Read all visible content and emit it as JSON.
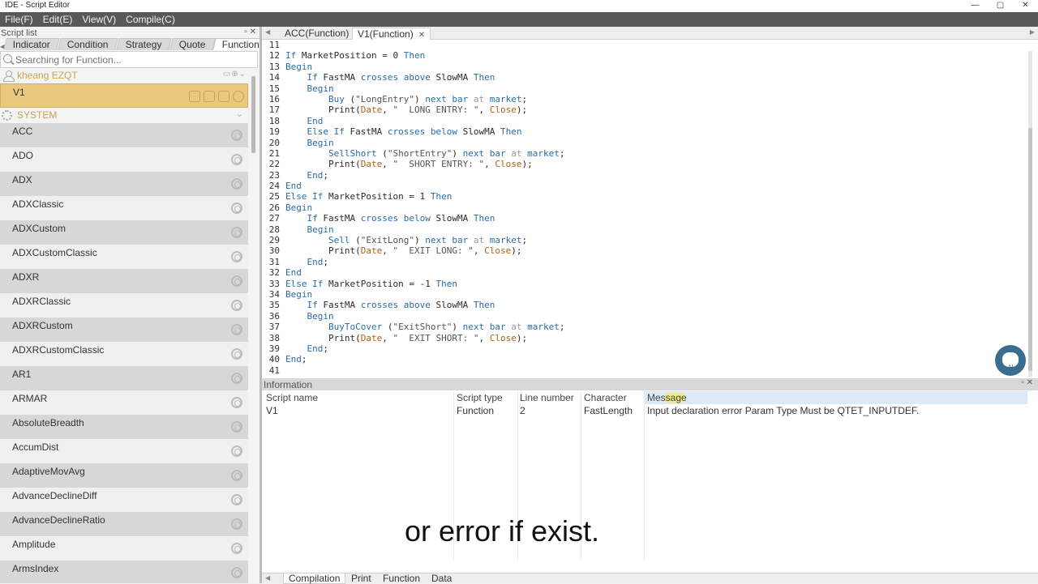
{
  "window": {
    "title": "IDE - Script Editor",
    "controls": [
      "—",
      "▢",
      "✕"
    ]
  },
  "menu": [
    "File(F)",
    "Edit(E)",
    "View(V)",
    "Compile(C)"
  ],
  "script_list": {
    "title": "Script list",
    "tabs": [
      "Indicator",
      "Condition",
      "Strategy",
      "Quote",
      "Function"
    ],
    "active_tab": "Function",
    "search_placeholder": "Searching for Function...",
    "user": "kheang EZQT",
    "selected_item": "V1",
    "system_label": "SYSTEM",
    "items": [
      "ACC",
      "ADO",
      "ADX",
      "ADXClassic",
      "ADXCustom",
      "ADXCustomClassic",
      "ADXR",
      "ADXRClassic",
      "ADXRCustom",
      "ADXRCustomClassic",
      "AR1",
      "ARMAR",
      "AbsoluteBreadth",
      "AccumDist",
      "AdaptiveMovAvg",
      "AdvanceDeclineDiff",
      "AdvanceDeclineRatio",
      "Amplitude",
      "ArmsIndex"
    ]
  },
  "editor": {
    "tabs": [
      "ACC(Function)",
      "V1(Function)"
    ],
    "active_tab": "V1(Function)",
    "close_glyph": "✕",
    "lines": [
      {
        "n": "11",
        "t": ""
      },
      {
        "n": "12",
        "t": "If MarketPosition = 0 Then"
      },
      {
        "n": "13",
        "t": "Begin"
      },
      {
        "n": "14",
        "t": "    If FastMA crosses above SlowMA Then"
      },
      {
        "n": "15",
        "t": "    Begin"
      },
      {
        "n": "16",
        "t": "        Buy (\"LongEntry\") next bar at market;"
      },
      {
        "n": "17",
        "t": "        Print(Date, \"  LONG ENTRY: \", Close);"
      },
      {
        "n": "18",
        "t": "    End"
      },
      {
        "n": "19",
        "t": "    Else If FastMA crosses below SlowMA Then"
      },
      {
        "n": "20",
        "t": "    Begin"
      },
      {
        "n": "21",
        "t": "        SellShort (\"ShortEntry\") next bar at market;"
      },
      {
        "n": "22",
        "t": "        Print(Date, \"  SHORT ENTRY: \", Close);"
      },
      {
        "n": "23",
        "t": "    End;"
      },
      {
        "n": "24",
        "t": "End"
      },
      {
        "n": "25",
        "t": "Else If MarketPosition = 1 Then"
      },
      {
        "n": "26",
        "t": "Begin"
      },
      {
        "n": "27",
        "t": "    If FastMA crosses below SlowMA Then"
      },
      {
        "n": "28",
        "t": "    Begin"
      },
      {
        "n": "29",
        "t": "        Sell (\"ExitLong\") next bar at market;"
      },
      {
        "n": "30",
        "t": "        Print(Date, \"  EXIT LONG: \", Close);"
      },
      {
        "n": "31",
        "t": "    End;"
      },
      {
        "n": "32",
        "t": "End"
      },
      {
        "n": "33",
        "t": "Else If MarketPosition = -1 Then"
      },
      {
        "n": "34",
        "t": "Begin"
      },
      {
        "n": "35",
        "t": "    If FastMA crosses above SlowMA Then"
      },
      {
        "n": "36",
        "t": "    Begin"
      },
      {
        "n": "37",
        "t": "        BuyToCover (\"ExitShort\") next bar at market;"
      },
      {
        "n": "38",
        "t": "        Print(Date, \"  EXIT SHORT: \", Close);"
      },
      {
        "n": "39",
        "t": "    End;"
      },
      {
        "n": "40",
        "t": "End;"
      },
      {
        "n": "41",
        "t": ""
      }
    ],
    "ai_label": "AI"
  },
  "information": {
    "title": "Information",
    "columns": [
      "Script name",
      "Script type",
      "Line number",
      "Character",
      "Message"
    ],
    "rows": [
      [
        "V1",
        "Function",
        "2",
        "FastLength",
        "Input declaration error Param Type Must be QTET_INPUTDEF."
      ]
    ],
    "caption": "or error if exist.",
    "bottom_tabs": [
      "Compilation",
      "Print",
      "Function",
      "Data"
    ],
    "active_bottom_tab": "Compilation"
  },
  "colors": {
    "keyword": "#2a6ca8",
    "identifier": "#b05f10",
    "selection": "#e9c97d",
    "menubar": "#585858"
  }
}
